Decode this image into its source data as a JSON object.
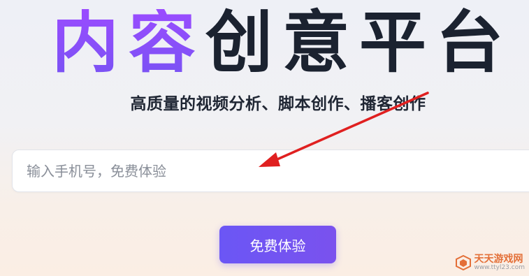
{
  "hero": {
    "title_highlight": "内容",
    "title_rest": "创意平台",
    "subtitle": "高质量的视频分析、脚本创作、播客创作"
  },
  "signup": {
    "phone_placeholder": "输入手机号，免费体验",
    "phone_value": "",
    "submit_label": "免费体验"
  },
  "colors": {
    "accent": "#7a52f4",
    "annotation_arrow": "#e02020",
    "title_dark": "#1b2230"
  },
  "watermark": {
    "name": "天天游戏网",
    "url": "www.ttyl23.com",
    "icon": "watermark-logo-icon"
  }
}
